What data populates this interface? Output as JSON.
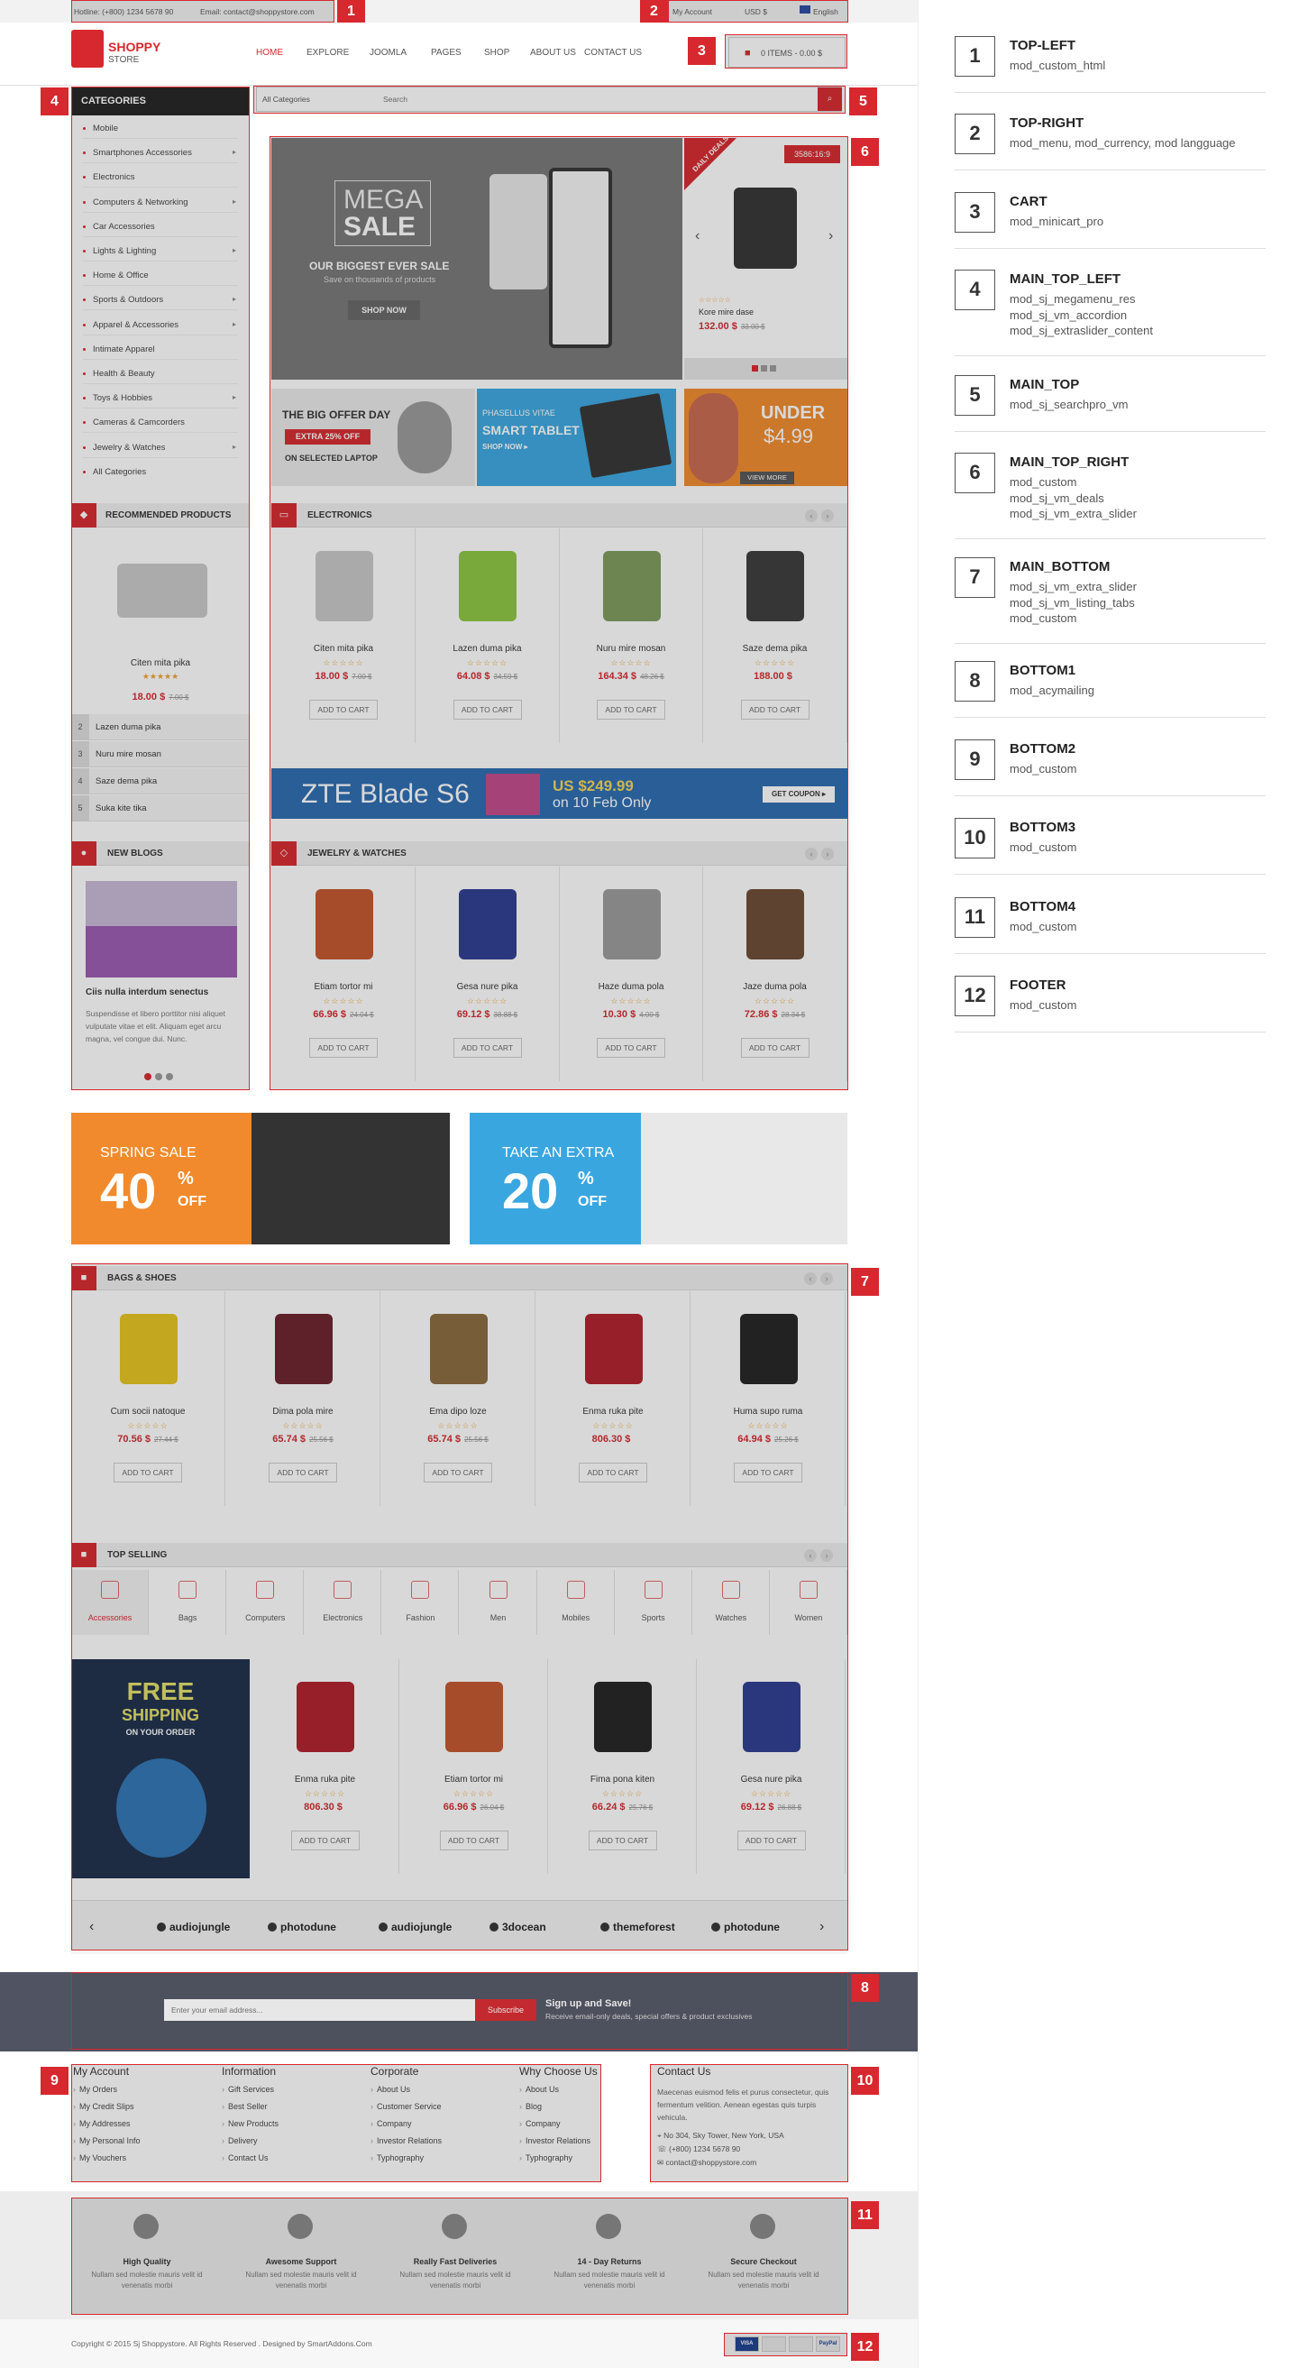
{
  "topbar": {
    "hotline": "Hotline: (+800) 1234 5678 90",
    "email": "Email: contact@shoppystore.com",
    "account": "My Account",
    "currency": "USD $",
    "language": "English"
  },
  "logo": {
    "line1": "SHOPPY",
    "line2": "STORE"
  },
  "nav": [
    "HOME",
    "EXPLORE",
    "JOOMLA",
    "PAGES",
    "SHOP",
    "ABOUT US",
    "CONTACT US"
  ],
  "cart": {
    "label": "0 ITEMS - 0.00 $"
  },
  "categories": {
    "title": "CATEGORIES",
    "items": [
      "Mobile",
      "Smartphones Accessories",
      "Electronics",
      "Computers & Networking",
      "Car Accessories",
      "Lights & Lighting",
      "Home & Office",
      "Sports & Outdoors",
      "Apparel & Accessories",
      "Intimate Apparel",
      "Health & Beauty",
      "Toys & Hobbies",
      "Cameras & Camcorders",
      "Jewelry & Watches",
      "All Categories"
    ],
    "has_sub": [
      false,
      true,
      false,
      true,
      false,
      true,
      false,
      true,
      true,
      false,
      false,
      true,
      false,
      true,
      false
    ]
  },
  "search": {
    "category": "All Categories",
    "placeholder": "Search"
  },
  "slider": {
    "size_badge": "3586:16:9",
    "mega": "MEGA",
    "sale": "SALE",
    "headline": "OUR BIGGEST EVER SALE",
    "sub": "Save on thousands of products",
    "btn": "SHOP NOW"
  },
  "deals": {
    "ribbon": "DAILY DEALS",
    "name": "Kore mire dase",
    "price": "132.00 $",
    "old": "33.00 $"
  },
  "banners": {
    "big_offer": "THE BIG OFFER DAY",
    "extra": "EXTRA 25% OFF",
    "laptop": "ON SELECTED LAPTOP",
    "phasellus": "PHASELLUS VITAE",
    "tablet": "SMART TABLET",
    "shop_now": "SHOP NOW ▸",
    "under": "UNDER",
    "under_price": "$4.99",
    "view_more": "VIEW MORE"
  },
  "recommended": {
    "title": "RECOMMENDED PRODUCTS",
    "main_name": "Citen mita pika",
    "main_price": "18.00 $",
    "main_old": "7.00 $",
    "list": [
      "Lazen duma pika",
      "Nuru mire mosan",
      "Saze dema pika",
      "Suka kite tika"
    ]
  },
  "blogs": {
    "title": "NEW BLOGS",
    "post_title": "Ciis nulla interdum senectus",
    "post_text": "Suspendisse et libero porttitor nisi aliquet vulputate vitae et elit. Aliquam eget arcu magna, vel congue dui. Nunc."
  },
  "electronics": {
    "title": "ELECTRONICS",
    "products": [
      {
        "name": "Citen mita pika",
        "price": "18.00 $",
        "old": "7.00 $"
      },
      {
        "name": "Lazen duma pika",
        "price": "64.08 $",
        "old": "34.59 $"
      },
      {
        "name": "Nuru mire mosan",
        "price": "164.34 $",
        "old": "48.26 $"
      },
      {
        "name": "Saze dema pika",
        "price": "188.00 $",
        "old": ""
      }
    ]
  },
  "zte": {
    "model": "ZTE Blade S6",
    "price": "US $249.99",
    "date": "on 10 Feb Only",
    "btn": "GET COUPON ▸"
  },
  "jewelry": {
    "title": "JEWELRY & WATCHES",
    "products": [
      {
        "name": "Etiam tortor mi",
        "price": "66.96 $",
        "old": "24.04 $"
      },
      {
        "name": "Gesa nure pika",
        "price": "69.12 $",
        "old": "38.88 $"
      },
      {
        "name": "Haze duma pola",
        "price": "10.30 $",
        "old": "4.00 $"
      },
      {
        "name": "Jaze duma pola",
        "price": "72.86 $",
        "old": "28.34 $"
      }
    ]
  },
  "add_to_cart": "ADD TO CART",
  "promo": {
    "spring": "SPRING SALE",
    "spring_pct": "40",
    "take": "TAKE AN EXTRA",
    "take_pct": "20",
    "pct_sym": "%",
    "off": "OFF"
  },
  "bags": {
    "title": "BAGS & SHOES",
    "products": [
      {
        "name": "Cum socii natoque",
        "price": "70.56 $",
        "old": "27.44 $"
      },
      {
        "name": "Dima pola mire",
        "price": "65.74 $",
        "old": "25.56 $"
      },
      {
        "name": "Ema dipo loze",
        "price": "65.74 $",
        "old": "25.56 $"
      },
      {
        "name": "Enma ruka pite",
        "price": "806.30 $",
        "old": ""
      },
      {
        "name": "Huma supo ruma",
        "price": "64.94 $",
        "old": "25.26 $"
      }
    ]
  },
  "top_selling": {
    "title": "TOP SELLING",
    "tabs": [
      "Accessories",
      "Bags",
      "Computers",
      "Electronics",
      "Fashion",
      "Men",
      "Mobiles",
      "Sports",
      "Watches",
      "Women"
    ],
    "shipping1": "FREE",
    "shipping2": "SHIPPING",
    "shipping3": "ON YOUR ORDER",
    "products": [
      {
        "name": "Enma ruka pite",
        "price": "806.30 $",
        "old": ""
      },
      {
        "name": "Etiam tortor mi",
        "price": "66.96 $",
        "old": "26.04 $"
      },
      {
        "name": "Fima pona kiten",
        "price": "66.24 $",
        "old": "25.76 $"
      },
      {
        "name": "Gesa nure pika",
        "price": "69.12 $",
        "old": "26.88 $"
      }
    ]
  },
  "brands": [
    "audiojungle",
    "photodune",
    "audiojungle",
    "3docean",
    "themeforest",
    "photodune"
  ],
  "newsletter": {
    "placeholder": "Enter your email address...",
    "btn": "Subscribe",
    "title": "Sign up and Save!",
    "sub": "Receive email-only deals, special offers & product exclusives"
  },
  "footer": {
    "cols": [
      {
        "title": "My Account",
        "items": [
          "My Orders",
          "My Credit Slips",
          "My Addresses",
          "My Personal Info",
          "My Vouchers"
        ]
      },
      {
        "title": "Information",
        "items": [
          "Gift Services",
          "Best Seller",
          "New Products",
          "Delivery",
          "Contact Us"
        ]
      },
      {
        "title": "Corporate",
        "items": [
          "About Us",
          "Customer Service",
          "Company",
          "Investor Relations",
          "Typhography"
        ]
      },
      {
        "title": "Why Choose Us",
        "items": [
          "About Us",
          "Blog",
          "Company",
          "Investor Relations",
          "Typhography"
        ]
      }
    ],
    "contact_title": "Contact Us",
    "contact_text": "Maecenas euismod felis et purus consectetur, quis fermentum velition. Aenean egestas quis turpis vehicula.",
    "address": "No 304, Sky Tower, New York, USA",
    "phone": "(+800) 1234 5678 90",
    "email": "contact@shoppystore.com"
  },
  "features": [
    {
      "title": "High Quality",
      "text": "Nullam sed molestie mauris velit id venenatis morbi"
    },
    {
      "title": "Awesome Support",
      "text": "Nullam sed molestie mauris velit id venenatis morbi"
    },
    {
      "title": "Really Fast Deliveries",
      "text": "Nullam sed molestie mauris velit id venenatis morbi"
    },
    {
      "title": "14 - Day Returns",
      "text": "Nullam sed molestie mauris velit id venenatis morbi"
    },
    {
      "title": "Secure Checkout",
      "text": "Nullam sed molestie mauris velit id venenatis morbi"
    }
  ],
  "copyright": "Copyright © 2015 Sj Shoppystore. All Rights Reserved . Designed by SmartAddons.Com",
  "payments": [
    "VISA",
    "",
    "",
    "PayPal"
  ],
  "legend": [
    {
      "n": "1",
      "t": "TOP-LEFT",
      "d": "mod_custom_html"
    },
    {
      "n": "2",
      "t": "TOP-RIGHT",
      "d": "mod_menu, mod_currency, mod langguage"
    },
    {
      "n": "3",
      "t": "CART",
      "d": "mod_minicart_pro"
    },
    {
      "n": "4",
      "t": "MAIN_TOP_LEFT",
      "d": "mod_sj_megamenu_res\nmod_sj_vm_accordion\nmod_sj_extraslider_content"
    },
    {
      "n": "5",
      "t": "MAIN_TOP",
      "d": "mod_sj_searchpro_vm"
    },
    {
      "n": "6",
      "t": "MAIN_TOP_RIGHT",
      "d": "mod_custom\nmod_sj_vm_deals\nmod_sj_vm_extra_slider"
    },
    {
      "n": "7",
      "t": "MAIN_BOTTOM",
      "d": "mod_sj_vm_extra_slider\nmod_sj_vm_listing_tabs\nmod_custom"
    },
    {
      "n": "8",
      "t": "BOTTOM1",
      "d": "mod_acymailing"
    },
    {
      "n": "9",
      "t": "BOTTOM2",
      "d": "mod_custom"
    },
    {
      "n": "10",
      "t": "BOTTOM3",
      "d": "mod_custom"
    },
    {
      "n": "11",
      "t": "BOTTOM4",
      "d": "mod_custom"
    },
    {
      "n": "12",
      "t": "FOOTER",
      "d": "mod_custom"
    }
  ],
  "colors": {
    "accent": "#d6282e",
    "overlay": "rgba(40,40,40,0.18)",
    "star": "#f0a12c",
    "blue_banner": "#3aa6e0",
    "orange_banner": "#f08a2c"
  }
}
